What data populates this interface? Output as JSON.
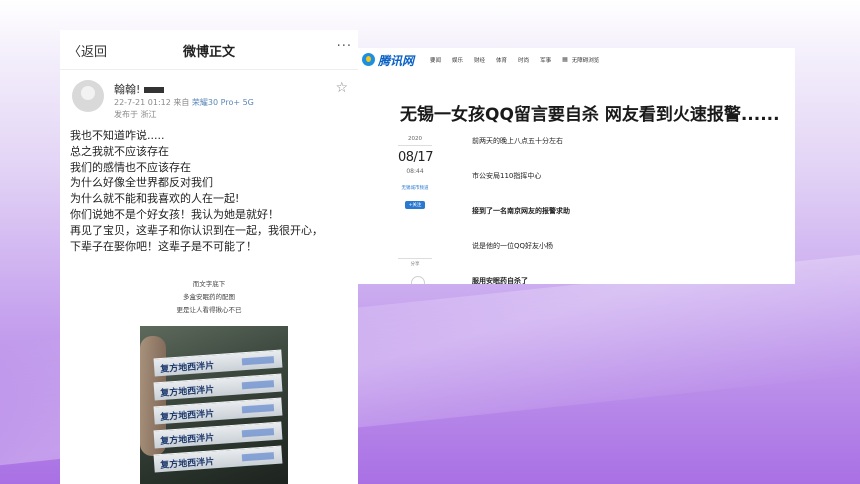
{
  "weibo": {
    "nav": {
      "back": "〈返回",
      "title": "微博正文",
      "more": "···"
    },
    "author": {
      "name": "翰翰!",
      "meta": "22-7-21 01:12 来自",
      "device": "荣耀30 Pro+ 5G",
      "location": "发布于 浙江"
    },
    "post_lines": [
      "我也不知道咋说.....",
      "总之我就不应该存在",
      "我们的感情也不应该存在",
      "为什么好像全世界都反对我们",
      "为什么就不能和我喜欢的人在一起!",
      "你们说她不是个好女孩！我认为她是就好！",
      "再见了宝贝，这辈子和你认识到在一起，我很开心，",
      "下辈子在娶你吧！这辈子是不可能了！"
    ],
    "caption_lines": [
      "而文字底下",
      "多盒安眠药的配图",
      "更是让人看得揪心不已"
    ],
    "photo_box_label": "复方地西泮片"
  },
  "tencent": {
    "logo": "腾讯网",
    "nav_items": [
      "要闻",
      "娱乐",
      "财经",
      "体育",
      "时尚",
      "军事",
      "无障碍浏览"
    ],
    "headline": "无锡一女孩QQ留言要自杀 网友看到火速报警......",
    "date": {
      "year": "2020",
      "day": "08/17",
      "time": "08:44"
    },
    "source": "无锡城市频道",
    "follow": "+关注",
    "share": "分享",
    "paragraphs": [
      {
        "text": "前两天的晚上八点五十分左右",
        "bold": false
      },
      {
        "text": "市公安局110指挥中心",
        "bold": false
      },
      {
        "text": "接到了一名南京网友的报警求助",
        "bold": true
      },
      {
        "text": "说是他的一位QQ好友小杨",
        "bold": false
      },
      {
        "text": "服用安眠药自杀了",
        "bold": true
      }
    ]
  },
  "colors": {
    "tencent_blue": "#0b62c6",
    "weibo_device_blue": "#5b87b8",
    "background_top": "#f3eefb",
    "background_bottom": "#a970e4"
  }
}
